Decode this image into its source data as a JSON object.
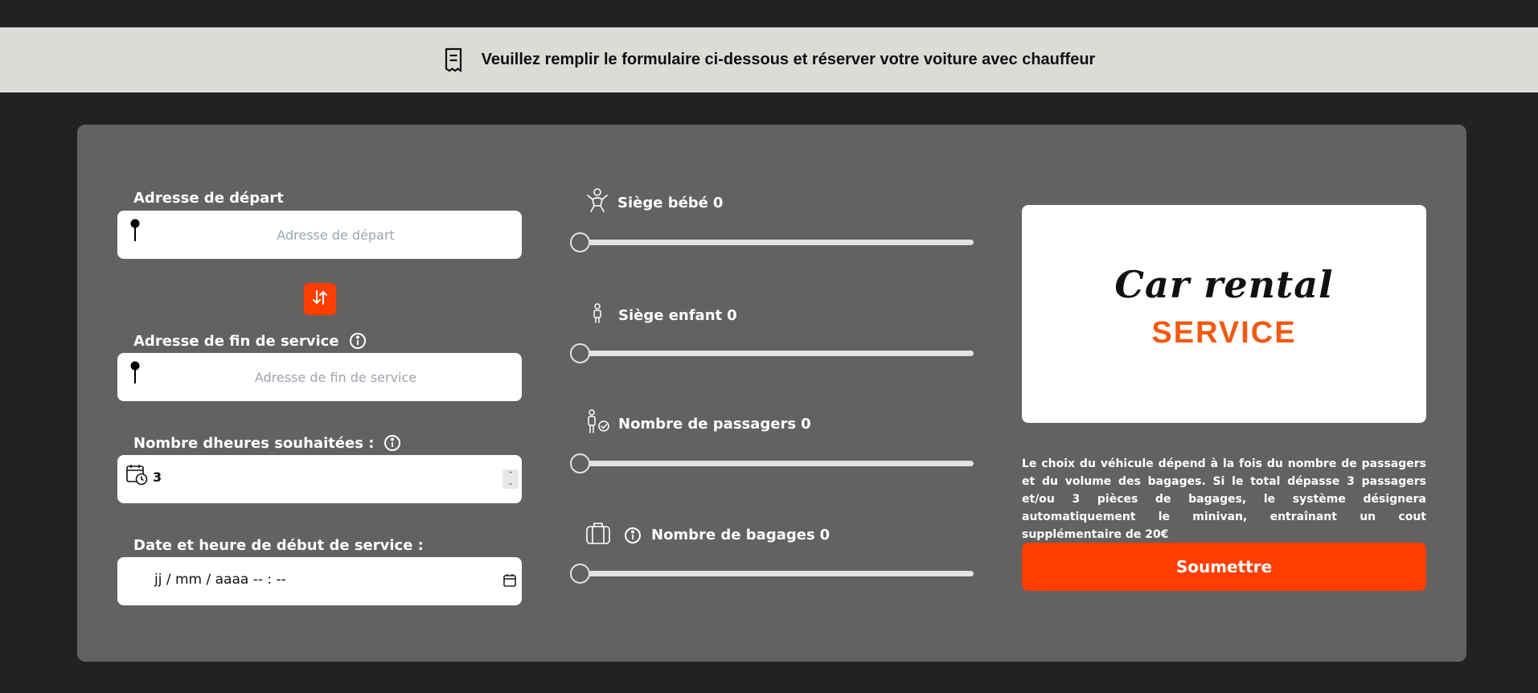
{
  "banner": {
    "text": "Veuillez remplir le formulaire ci-dessous et réserver votre voiture avec chauffeur"
  },
  "form": {
    "departure": {
      "label": "Adresse de départ",
      "placeholder": "Adresse de départ"
    },
    "end_address": {
      "label": "Adresse de fin de service",
      "placeholder": "Adresse de fin de service"
    },
    "hours": {
      "label": "Nombre dheures souhaitées :",
      "value": "3"
    },
    "start_datetime": {
      "label": "Date et heure de début de service :",
      "placeholder": "jj / mm / aaaa  -- : --"
    }
  },
  "sliders": [
    {
      "label": "Siège bébé",
      "value": "0",
      "icon": "baby-icon"
    },
    {
      "label": "Siège enfant",
      "value": "0",
      "icon": "child-icon"
    },
    {
      "label": "Nombre de passagers",
      "value": "0",
      "icon": "passenger-icon"
    },
    {
      "label": "Nombre de bagages",
      "value": "0",
      "icon": "luggage-icon"
    }
  ],
  "logo": {
    "line1": "Car rental",
    "line2": "SERVICE"
  },
  "notice": "Le choix du véhicule dépend à la fois du nombre de passagers et du volume des bagages. Si le total dépasse 3 passagers et/ou 3 pièces de bagages, le système désignera automatiquement le minivan, entraînant un cout supplémentaire de 20€",
  "submit_label": "Soumettre",
  "colors": {
    "accent": "#ff3d00",
    "panel": "#636260",
    "background": "#222222",
    "banner": "#dcdbd8"
  }
}
